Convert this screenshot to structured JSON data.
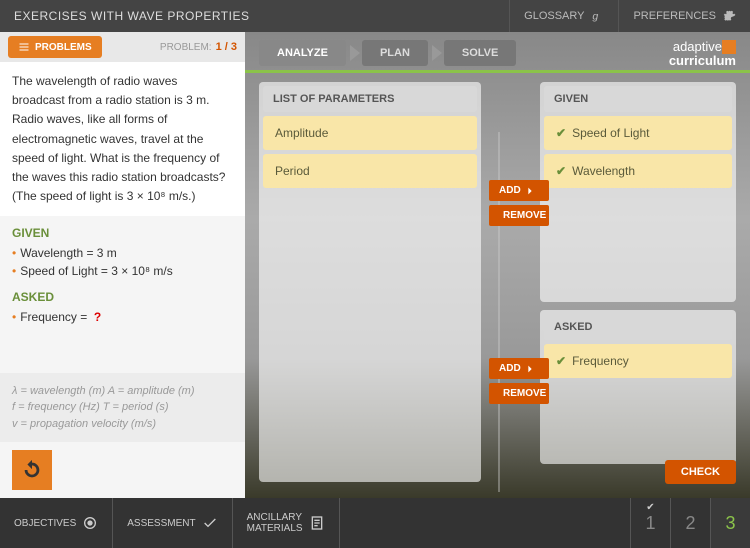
{
  "header": {
    "title": "EXERCISES WITH WAVE PROPERTIES",
    "glossary": "GLOSSARY",
    "preferences": "PREFERENCES"
  },
  "sidebar": {
    "problems_btn": "PROBLEMS",
    "problem_label": "PROBLEM:",
    "problem_count": "1 / 3",
    "problem_text_1": "The wavelength of radio waves broadcast from a radio station is 3 m. Radio waves, like all forms of electromagnetic waves, travel at the speed of light. What is the frequency of the waves this radio station broadcasts?",
    "problem_text_2": "(The speed of light is 3 × 10⁸ m/s.)",
    "given_label": "GIVEN",
    "given_items": [
      "Wavelength = 3 m",
      "Speed of Light = 3 × 10⁸ m/s"
    ],
    "asked_label": "ASKED",
    "asked_item": "Frequency =",
    "asked_mark": "?",
    "legend_1": "λ = wavelength (m) A = amplitude (m)",
    "legend_2": "f = frequency (Hz) T = period (s)",
    "legend_3": "v = propagation velocity (m/s)"
  },
  "steps": {
    "analyze": "ANALYZE",
    "plan": "PLAN",
    "solve": "SOLVE"
  },
  "logo": {
    "top": "adaptive",
    "bottom": "curriculum"
  },
  "panels": {
    "params_title": "LIST OF PARAMETERS",
    "params_items": [
      "Amplitude",
      "Period"
    ],
    "given_title": "GIVEN",
    "given_items": [
      "Speed  of  Light",
      "Wavelength"
    ],
    "asked_title": "ASKED",
    "asked_items": [
      "Frequency"
    ]
  },
  "buttons": {
    "add": "ADD",
    "remove": "REMOVE",
    "check": "CHECK"
  },
  "footer": {
    "objectives": "OBJECTIVES",
    "assessment": "ASSESSMENT",
    "ancillary_1": "ANCILLARY",
    "ancillary_2": "MATERIALS",
    "pages": [
      "1",
      "2",
      "3"
    ]
  }
}
